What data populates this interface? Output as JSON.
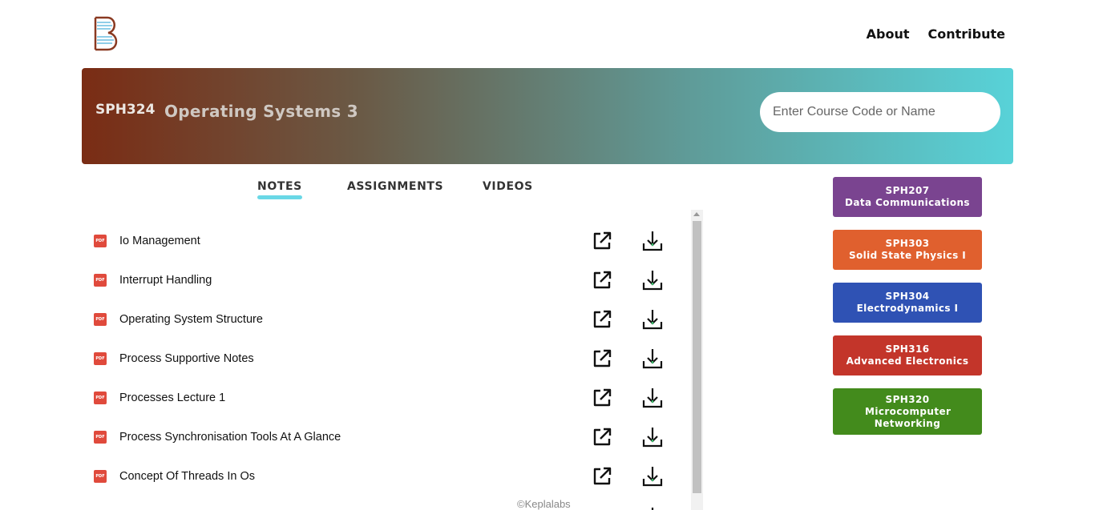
{
  "nav": {
    "about_label": "About",
    "contribute_label": "Contribute"
  },
  "banner": {
    "course_code": "SPH324",
    "course_name": "Operating Systems 3",
    "search_placeholder": "Enter Course Code or Name"
  },
  "tabs": [
    {
      "label": "NOTES",
      "active": true
    },
    {
      "label": "ASSIGNMENTS",
      "active": false
    },
    {
      "label": "VIDEOS",
      "active": false
    }
  ],
  "notes": [
    {
      "icon": "pdf-icon",
      "title": "Io Management"
    },
    {
      "icon": "pdf-icon",
      "title": "Interrupt Handling"
    },
    {
      "icon": "pdf-icon",
      "title": "Operating System Structure"
    },
    {
      "icon": "pdf-icon",
      "title": "Process Supportive Notes"
    },
    {
      "icon": "pdf-icon",
      "title": "Processes Lecture 1"
    },
    {
      "icon": "pdf-icon",
      "title": "Process Synchronisation Tools At A Glance"
    },
    {
      "icon": "pdf-icon",
      "title": "Concept Of Threads In Os"
    }
  ],
  "pdf_badge_text": "PDF",
  "footer": {
    "text": "©Keplalabs"
  },
  "related_courses": [
    {
      "code": "SPH207",
      "name": "Data Communications",
      "color": "#7a4490"
    },
    {
      "code": "SPH303",
      "name": "Solid State Physics I",
      "color": "#e0602e"
    },
    {
      "code": "SPH304",
      "name": "Electrodynamics I",
      "color": "#2f52b4"
    },
    {
      "code": "SPH316",
      "name": "Advanced Electronics",
      "color": "#c3352a"
    },
    {
      "code": "SPH320",
      "name": "Microcomputer Networking",
      "color": "#438b1c"
    }
  ],
  "colors": {
    "tab_underline": "#6ad8e6",
    "pdf_icon": "#e04a3c",
    "download_accent": "#3cb96b",
    "logo_brown": "#8a3a22",
    "logo_blue": "#6bbde0"
  }
}
